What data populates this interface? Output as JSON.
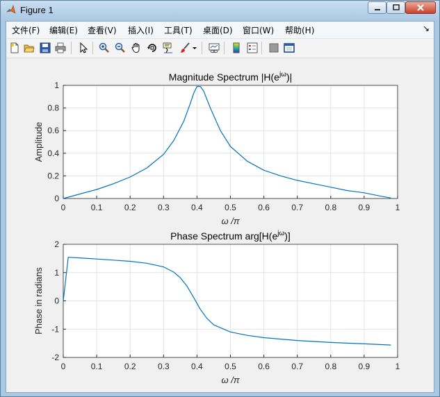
{
  "window": {
    "title": "Figure 1",
    "controls": {
      "minimize": "minimize",
      "maximize": "maximize",
      "close": "close"
    }
  },
  "menu": {
    "items": [
      "文件(F)",
      "编辑(E)",
      "查看(V)",
      "插入(I)",
      "工具(T)",
      "桌面(D)",
      "窗口(W)",
      "帮助(H)"
    ],
    "overflow_arrow": "↘"
  },
  "toolbar": {
    "icons": [
      "new-figure-icon",
      "open-folder-icon",
      "save-icon",
      "print-icon",
      "pointer-icon",
      "zoom-in-icon",
      "zoom-out-icon",
      "pan-hand-icon",
      "rotate-3d-icon",
      "data-cursor-icon",
      "brush-icon",
      "brush-dropdown-icon",
      "link-plot-icon",
      "colorbar-icon",
      "legend-icon",
      "hide-plot-tools-icon",
      "show-plot-tools-icon"
    ]
  },
  "chart_data": [
    {
      "type": "line",
      "title": "Magnitude Spectrum |H(e^jω)|",
      "xlabel": "ω /π",
      "ylabel": "Amplitude",
      "xlim": [
        0,
        1
      ],
      "ylim": [
        0,
        1
      ],
      "x_ticks": [
        "0",
        "0.1",
        "0.2",
        "0.3",
        "0.4",
        "0.5",
        "0.6",
        "0.7",
        "0.8",
        "0.9",
        "1"
      ],
      "y_ticks": [
        "0",
        "0.2",
        "0.4",
        "0.6",
        "0.8",
        "1"
      ],
      "grid": true,
      "color": "#0072BD",
      "x": [
        0,
        0.05,
        0.1,
        0.15,
        0.2,
        0.25,
        0.3,
        0.33,
        0.36,
        0.38,
        0.39,
        0.4,
        0.41,
        0.42,
        0.44,
        0.47,
        0.5,
        0.55,
        0.6,
        0.65,
        0.7,
        0.75,
        0.8,
        0.85,
        0.9,
        0.95,
        0.98
      ],
      "y": [
        0,
        0.04,
        0.08,
        0.13,
        0.19,
        0.27,
        0.39,
        0.51,
        0.68,
        0.84,
        0.93,
        0.99,
        0.99,
        0.95,
        0.8,
        0.6,
        0.46,
        0.33,
        0.25,
        0.2,
        0.16,
        0.13,
        0.1,
        0.07,
        0.05,
        0.02,
        0.005
      ]
    },
    {
      "type": "line",
      "title": "Phase Spectrum arg[H(e^jω)]",
      "xlabel": "ω /π",
      "ylabel": "Phase in radians",
      "xlim": [
        0,
        1
      ],
      "ylim": [
        -2,
        2
      ],
      "x_ticks": [
        "0",
        "0.1",
        "0.2",
        "0.3",
        "0.4",
        "0.5",
        "0.6",
        "0.7",
        "0.8",
        "0.9",
        "1"
      ],
      "y_ticks": [
        "-2",
        "-1",
        "0",
        "1",
        "2"
      ],
      "grid": true,
      "color": "#0072BD",
      "x": [
        0,
        0.015,
        0.05,
        0.1,
        0.15,
        0.2,
        0.25,
        0.3,
        0.33,
        0.35,
        0.37,
        0.39,
        0.41,
        0.43,
        0.45,
        0.5,
        0.55,
        0.6,
        0.7,
        0.8,
        0.9,
        0.98
      ],
      "y": [
        0,
        1.54,
        1.52,
        1.48,
        1.44,
        1.4,
        1.33,
        1.2,
        1.02,
        0.82,
        0.52,
        0.12,
        -0.3,
        -0.62,
        -0.85,
        -1.1,
        -1.22,
        -1.3,
        -1.4,
        -1.47,
        -1.52,
        -1.56
      ]
    }
  ]
}
